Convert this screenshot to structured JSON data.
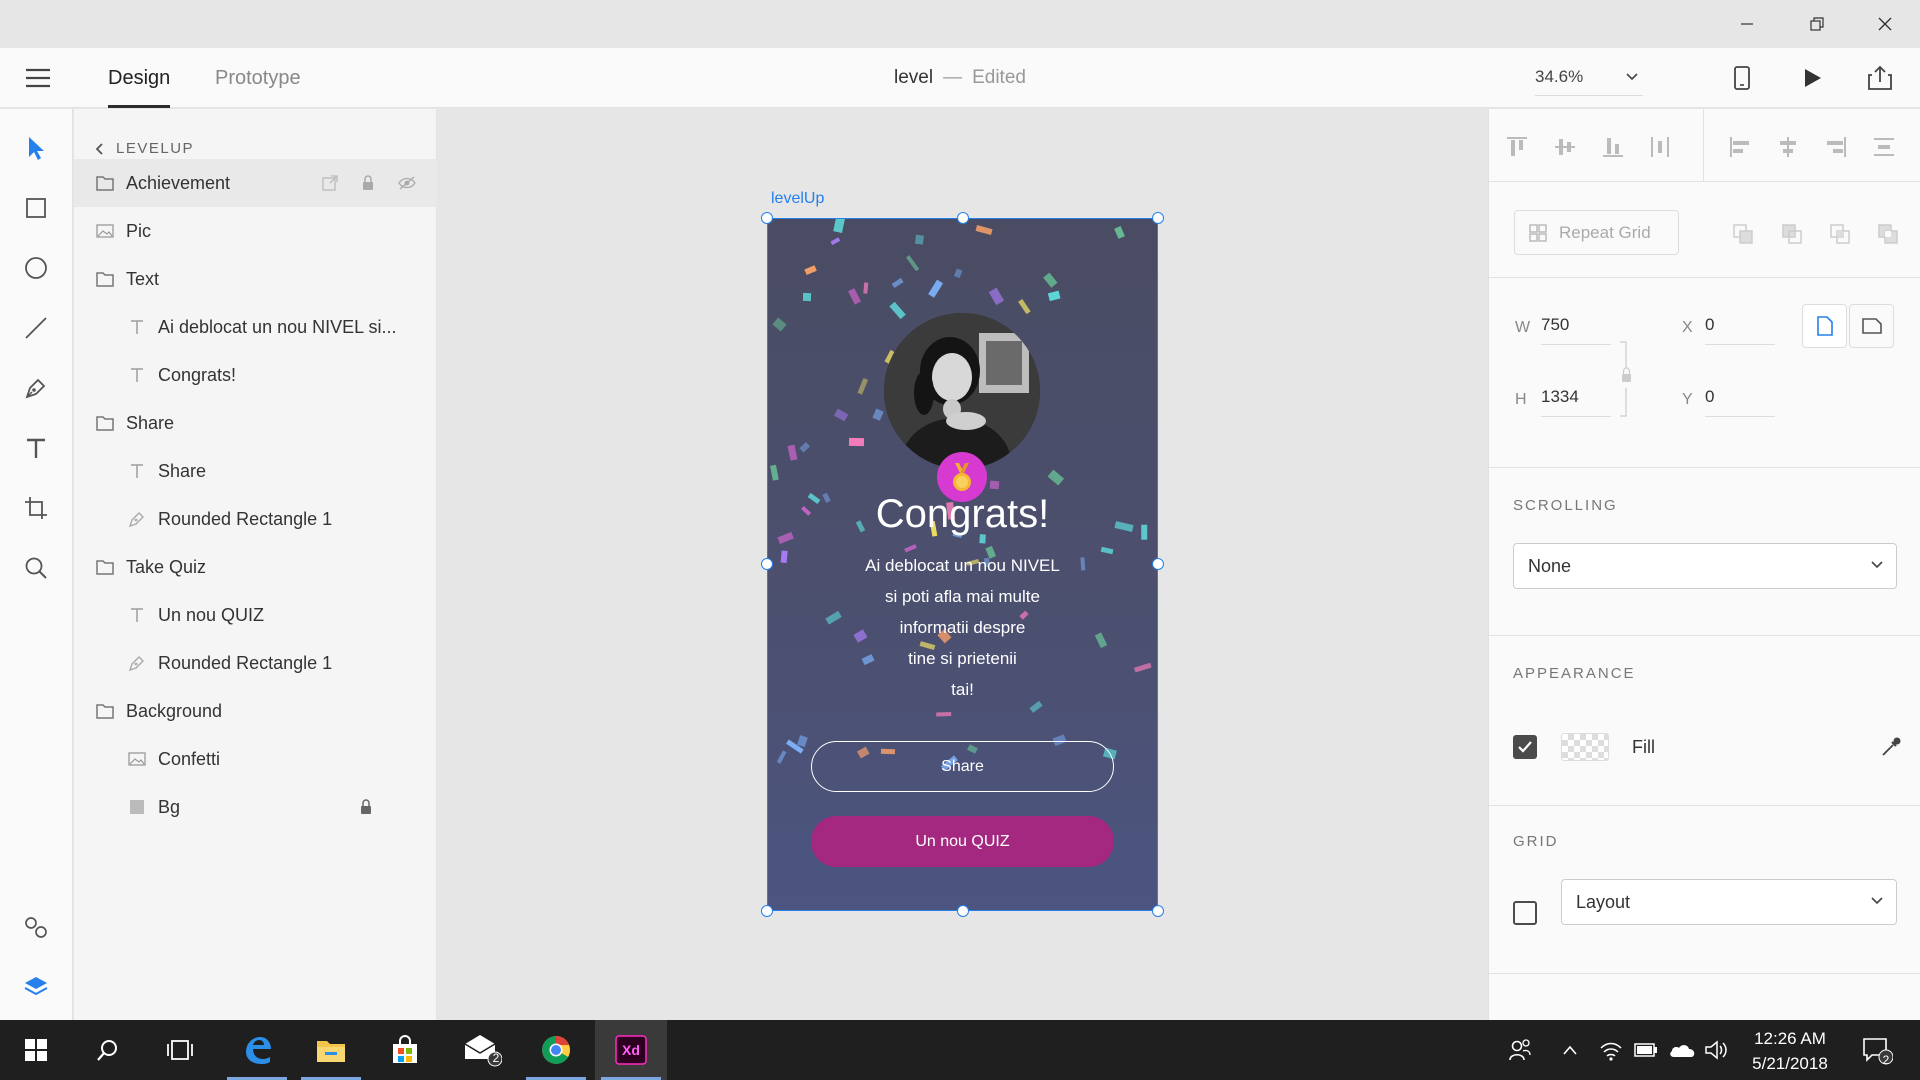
{
  "app": {
    "tabs": [
      {
        "label": "Design"
      },
      {
        "label": "Prototype"
      }
    ],
    "doc_name": "level",
    "doc_sep": "—",
    "doc_status": "Edited",
    "zoom": "34.6%"
  },
  "layers": {
    "breadcrumb": "LEVELUP",
    "items": [
      {
        "label": "Achievement",
        "icon": "folder-icon"
      },
      {
        "label": "Pic",
        "icon": "image-icon"
      },
      {
        "label": "Text",
        "icon": "folder-icon"
      },
      {
        "label": "Ai deblocat un nou NIVEL si...",
        "icon": "text-icon"
      },
      {
        "label": "Congrats!",
        "icon": "text-icon"
      },
      {
        "label": "Share",
        "icon": "folder-icon"
      },
      {
        "label": "Share",
        "icon": "text-icon"
      },
      {
        "label": "Rounded Rectangle 1",
        "icon": "path-icon"
      },
      {
        "label": "Take Quiz",
        "icon": "folder-icon"
      },
      {
        "label": "Un nou QUIZ",
        "icon": "text-icon"
      },
      {
        "label": "Rounded Rectangle 1",
        "icon": "path-icon"
      },
      {
        "label": "Background",
        "icon": "folder-icon"
      },
      {
        "label": "Confetti",
        "icon": "image-icon"
      },
      {
        "label": "Bg",
        "icon": "rectangle-icon"
      }
    ]
  },
  "artboard": {
    "name": "levelUp",
    "title": "Congrats!",
    "message": [
      "Ai deblocat un nou NIVEL",
      "si poti afla mai multe",
      "informatii despre",
      "tine si prietenii",
      "tai!"
    ],
    "share_label": "Share",
    "quiz_label": "Un nou QUIZ",
    "quiz_color": "#a4287f",
    "medal_color": "#d63ad0"
  },
  "inspector": {
    "repeat_grid": "Repeat Grid",
    "w_label": "W",
    "w_value": "750",
    "h_label": "H",
    "h_value": "1334",
    "x_label": "X",
    "x_value": "0",
    "y_label": "Y",
    "y_value": "0",
    "scrolling_title": "SCROLLING",
    "scrolling_value": "None",
    "appearance_title": "APPEARANCE",
    "fill_label": "Fill",
    "fill_checked": true,
    "grid_title": "GRID",
    "grid_value": "Layout",
    "grid_checked": false
  },
  "taskbar": {
    "time": "12:26 AM",
    "date": "5/21/2018",
    "mail_badge": "2",
    "notif_badge": "2"
  }
}
